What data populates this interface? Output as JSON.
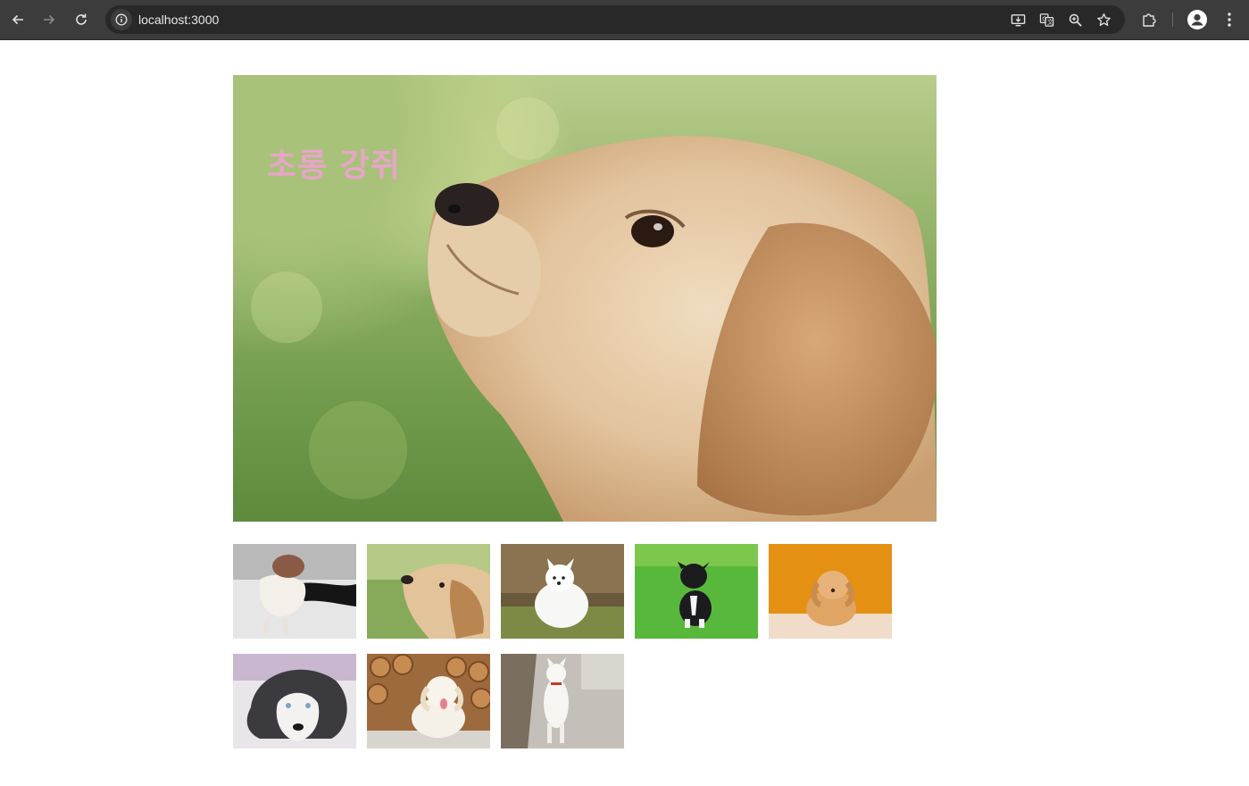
{
  "browser": {
    "url": "localhost:3000",
    "icons": [
      "back-icon",
      "forward-icon",
      "reload-icon",
      "site-info-icon",
      "install-app-icon",
      "translate-icon",
      "zoom-icon",
      "bookmark-star-icon",
      "extensions-icon",
      "profile-icon",
      "menu-icon"
    ]
  },
  "hero": {
    "title": "초롱 강쥐"
  },
  "gallery": {
    "items": [
      "dog-photo-1",
      "dog-photo-2",
      "dog-photo-3",
      "dog-photo-4",
      "dog-photo-5",
      "dog-photo-6",
      "dog-photo-7",
      "dog-photo-8"
    ]
  },
  "colors": {
    "chrome": "#3c3c3c",
    "omnibox": "#282828",
    "title_pink": "#e7a6c8"
  }
}
